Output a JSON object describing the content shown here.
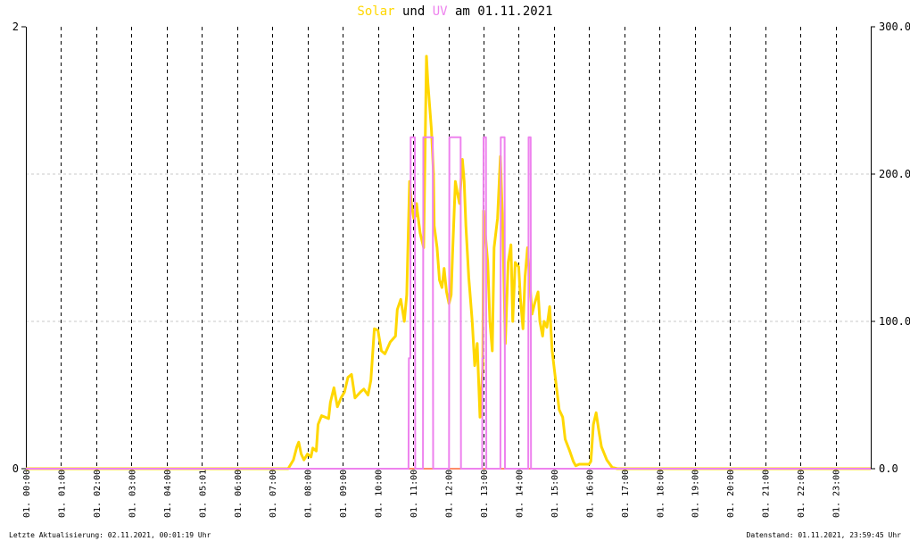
{
  "title_parts": {
    "solar": "Solar",
    "und": " und ",
    "uv": "UV",
    "date": " am 01.11.2021"
  },
  "footer": {
    "left": "Letzte Aktualisierung: 02.11.2021, 00:01:19 Uhr",
    "right": "Datenstand: 01.11.2021, 23:59:45 Uhr"
  },
  "colors": {
    "solar": "#ffd700",
    "uv": "#ee82ee",
    "baseline": "#ff8c69"
  },
  "chart_data": {
    "type": "line",
    "title": "Solar und UV am 01.11.2021",
    "x_range": [
      0,
      24
    ],
    "y_left_range": [
      0,
      2
    ],
    "y_right_range": [
      0,
      300
    ],
    "y_left_ticks": [
      "0",
      "2"
    ],
    "y_right_ticks": [
      "0.0",
      "100.0",
      "200.0",
      "300.0"
    ],
    "x_tick_labels": [
      "01. 00:00",
      "01. 01:00",
      "01. 02:00",
      "01. 03:00",
      "01. 04:00",
      "01. 05:01",
      "01. 06:00",
      "01. 07:00",
      "01. 08:00",
      "01. 09:00",
      "01. 10:00",
      "01. 11:00",
      "01. 12:00",
      "01. 13:00",
      "01. 14:00",
      "01. 15:00",
      "01. 16:00",
      "01. 17:00",
      "01. 18:00",
      "01. 19:00",
      "01. 20:00",
      "01. 21:00",
      "01. 22:00",
      "01. 23:00"
    ],
    "grid": true,
    "series": [
      {
        "name": "Solar",
        "axis": "right",
        "points": [
          [
            0,
            0
          ],
          [
            7.45,
            0
          ],
          [
            7.6,
            6
          ],
          [
            7.7,
            15
          ],
          [
            7.75,
            18
          ],
          [
            7.82,
            10
          ],
          [
            7.9,
            6
          ],
          [
            8.0,
            10
          ],
          [
            8.1,
            8
          ],
          [
            8.15,
            14
          ],
          [
            8.25,
            12
          ],
          [
            8.3,
            30
          ],
          [
            8.4,
            36
          ],
          [
            8.5,
            35
          ],
          [
            8.6,
            34
          ],
          [
            8.65,
            45
          ],
          [
            8.75,
            55
          ],
          [
            8.85,
            42
          ],
          [
            8.95,
            48
          ],
          [
            9.05,
            52
          ],
          [
            9.15,
            62
          ],
          [
            9.25,
            64
          ],
          [
            9.35,
            48
          ],
          [
            9.5,
            52
          ],
          [
            9.6,
            54
          ],
          [
            9.72,
            50
          ],
          [
            9.8,
            60
          ],
          [
            9.9,
            95
          ],
          [
            10.0,
            94
          ],
          [
            10.1,
            80
          ],
          [
            10.2,
            78
          ],
          [
            10.35,
            86
          ],
          [
            10.5,
            90
          ],
          [
            10.55,
            108
          ],
          [
            10.65,
            115
          ],
          [
            10.75,
            100
          ],
          [
            10.82,
            118
          ],
          [
            10.9,
            195
          ],
          [
            10.95,
            180
          ],
          [
            11.02,
            170
          ],
          [
            11.08,
            172
          ],
          [
            11.1,
            180
          ],
          [
            11.12,
            175
          ],
          [
            11.2,
            160
          ],
          [
            11.3,
            150
          ],
          [
            11.38,
            280
          ],
          [
            11.42,
            262
          ],
          [
            11.52,
            230
          ],
          [
            11.58,
            200
          ],
          [
            11.6,
            165
          ],
          [
            11.68,
            150
          ],
          [
            11.75,
            128
          ],
          [
            11.82,
            123
          ],
          [
            11.88,
            136
          ],
          [
            11.95,
            120
          ],
          [
            12.02,
            112
          ],
          [
            12.08,
            118
          ],
          [
            12.12,
            145
          ],
          [
            12.2,
            195
          ],
          [
            12.25,
            188
          ],
          [
            12.32,
            180
          ],
          [
            12.4,
            210
          ],
          [
            12.45,
            195
          ],
          [
            12.5,
            165
          ],
          [
            12.58,
            130
          ],
          [
            12.68,
            100
          ],
          [
            12.75,
            70
          ],
          [
            12.82,
            85
          ],
          [
            12.9,
            35
          ],
          [
            12.98,
            70
          ],
          [
            13.0,
            175
          ],
          [
            13.05,
            160
          ],
          [
            13.12,
            140
          ],
          [
            13.18,
            100
          ],
          [
            13.25,
            80
          ],
          [
            13.3,
            150
          ],
          [
            13.4,
            170
          ],
          [
            13.48,
            212
          ],
          [
            13.55,
            160
          ],
          [
            13.62,
            85
          ],
          [
            13.7,
            140
          ],
          [
            13.78,
            152
          ],
          [
            13.83,
            100
          ],
          [
            13.9,
            140
          ],
          [
            14.0,
            137
          ],
          [
            14.05,
            115
          ],
          [
            14.12,
            95
          ],
          [
            14.18,
            130
          ],
          [
            14.25,
            150
          ],
          [
            14.32,
            125
          ],
          [
            14.38,
            105
          ],
          [
            14.45,
            112
          ],
          [
            14.55,
            120
          ],
          [
            14.6,
            100
          ],
          [
            14.68,
            90
          ],
          [
            14.72,
            100
          ],
          [
            14.8,
            96
          ],
          [
            14.88,
            110
          ],
          [
            14.95,
            80
          ],
          [
            15.05,
            60
          ],
          [
            15.15,
            40
          ],
          [
            15.25,
            35
          ],
          [
            15.32,
            20
          ],
          [
            15.45,
            12
          ],
          [
            15.55,
            5
          ],
          [
            15.62,
            2
          ],
          [
            15.72,
            3
          ],
          [
            16.0,
            3
          ],
          [
            16.05,
            5
          ],
          [
            16.12,
            30
          ],
          [
            16.2,
            38
          ],
          [
            16.28,
            25
          ],
          [
            16.35,
            15
          ],
          [
            16.5,
            6
          ],
          [
            16.65,
            1
          ],
          [
            16.8,
            0
          ],
          [
            24,
            0
          ]
        ]
      },
      {
        "name": "UV",
        "axis": "left",
        "points": [
          [
            0,
            0
          ],
          [
            10.87,
            0
          ],
          [
            10.88,
            0.5
          ],
          [
            10.92,
            0.5
          ],
          [
            10.93,
            1.5
          ],
          [
            11.05,
            1.5
          ],
          [
            11.06,
            0
          ],
          [
            11.28,
            0
          ],
          [
            11.29,
            1.5
          ],
          [
            11.56,
            1.5
          ],
          [
            11.57,
            0
          ],
          [
            12.02,
            0
          ],
          [
            12.03,
            1.5
          ],
          [
            12.35,
            1.5
          ],
          [
            12.36,
            0
          ],
          [
            12.96,
            0
          ],
          [
            12.97,
            0.5
          ],
          [
            12.99,
            0.5
          ],
          [
            13.0,
            1.5
          ],
          [
            13.07,
            1.5
          ],
          [
            13.08,
            0
          ],
          [
            13.48,
            0
          ],
          [
            13.49,
            1.5
          ],
          [
            13.6,
            1.5
          ],
          [
            13.61,
            0
          ],
          [
            14.27,
            0
          ],
          [
            14.28,
            1.5
          ],
          [
            14.34,
            1.5
          ],
          [
            14.35,
            0
          ],
          [
            24,
            0
          ]
        ]
      }
    ]
  }
}
